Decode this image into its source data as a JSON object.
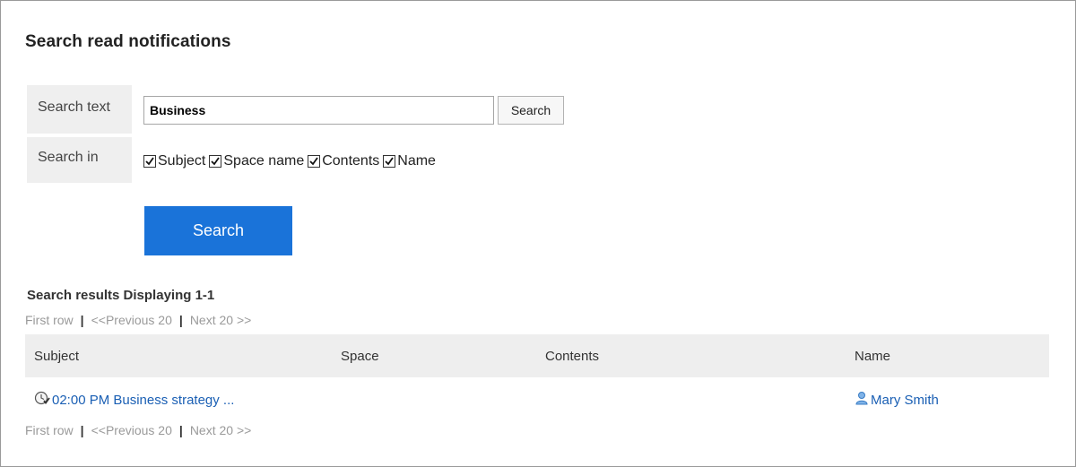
{
  "page": {
    "title": "Search read notifications"
  },
  "form": {
    "search_text_label": "Search text",
    "search_text_value": "Business",
    "inline_search_label": "Search",
    "search_in_label": "Search in",
    "search_in_options": [
      {
        "label": "Subject",
        "checked": true
      },
      {
        "label": "Space name",
        "checked": true
      },
      {
        "label": "Contents",
        "checked": true
      },
      {
        "label": "Name",
        "checked": true
      }
    ],
    "search_button_label": "Search"
  },
  "results": {
    "heading": "Search results Displaying 1-1",
    "pager": {
      "first": "First row",
      "sep": "|",
      "prev": "<<Previous 20",
      "next": "Next 20 >>"
    },
    "columns": [
      "Subject",
      "Space",
      "Contents",
      "Name"
    ],
    "rows": [
      {
        "subject": "02:00 PM Business strategy ...",
        "subject_icon": "schedule-event-icon",
        "space": "",
        "contents": "",
        "name": "Mary Smith",
        "name_icon": "user-icon"
      }
    ]
  },
  "colors": {
    "primary_button": "#1a73d9",
    "link": "#1a5fb4",
    "label_bg": "#efefef",
    "header_bg": "#eeeeee"
  }
}
